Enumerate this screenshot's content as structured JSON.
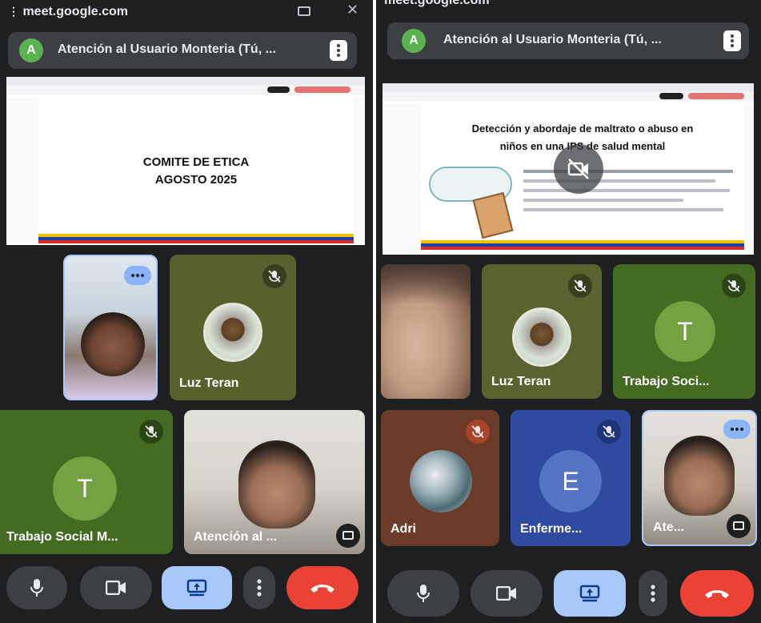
{
  "left": {
    "url": "meet.google.com",
    "meeting_title": "Atención al Usuario Monteria (Tú, ...",
    "avatar_letter": "A",
    "slide": {
      "line1": "COMITE DE ETICA",
      "line2": "AGOSTO 2025"
    },
    "tiles": [
      {
        "name": ""
      },
      {
        "name": "Luz Teran"
      },
      {
        "name": "Trabajo Social M...",
        "letter": "T"
      },
      {
        "name": "Atención al ..."
      }
    ]
  },
  "right": {
    "url": "meet.google.com",
    "meeting_title": "Atención al Usuario Monteria (Tú, ...",
    "avatar_letter": "A",
    "slide": {
      "title_line1": "Detección y abordaje de maltrato o abuso en",
      "title_line2": "niños en una IPS de salud mental"
    },
    "tiles": [
      {
        "name": ""
      },
      {
        "name": "Luz Teran"
      },
      {
        "name": "Trabajo Soci...",
        "letter": "T"
      },
      {
        "name": "Adri"
      },
      {
        "name": "Enferme...",
        "letter": "E"
      },
      {
        "name": "Ate..."
      }
    ]
  },
  "colors": {
    "bg": "#1e1f20",
    "green_tile": "#4a6f24",
    "blue_tile": "#2f4ba0",
    "end_call": "#ea4335",
    "present_btn": "#a8c7fa"
  }
}
